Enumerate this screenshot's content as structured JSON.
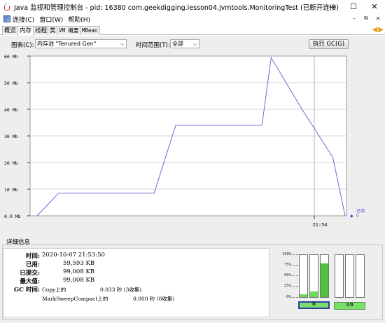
{
  "window": {
    "title": "Java 监视和管理控制台 - pid: 16380 com.geekdigging.lesson04.jvmtools.MonitoringTest (已断开连接)",
    "controls": {
      "minimize": "—",
      "maximize": "☐",
      "close": "✕"
    }
  },
  "menu": {
    "items": [
      "连接(C)",
      "窗口(W)",
      "帮助(H)"
    ],
    "inner_controls": [
      "–",
      "⧉",
      "✕"
    ]
  },
  "tabs": [
    "概览",
    "内存",
    "线程",
    "类",
    "VM 概要",
    "MBean"
  ],
  "active_tab": "内存",
  "controls": {
    "chart_label": "图表(C):",
    "chart_value": "内存池 \"Tenured Gen\"",
    "range_label": "时间范围(T):",
    "range_value": "全部",
    "gc_button": "执行 GC(G)"
  },
  "chart_data": {
    "type": "line",
    "y_ticks": [
      "60 Mb",
      "50 Mb",
      "40 Mb",
      "30 Mb",
      "20 Mb",
      "10 Mb",
      "0.0 Mb"
    ],
    "x_tick": "21:54",
    "ylim": [
      0,
      60
    ],
    "unit": "Mb",
    "grid": true,
    "series": [
      {
        "name": "已用",
        "color": "#6b6bd6",
        "points": [
          [
            0.0,
            0.0
          ],
          [
            0.07,
            8.5
          ],
          [
            0.38,
            8.5
          ],
          [
            0.45,
            34.0
          ],
          [
            0.73,
            34.0
          ],
          [
            0.76,
            59.4
          ],
          [
            0.86,
            40.0
          ],
          [
            0.96,
            22.0
          ],
          [
            1.0,
            0.0
          ]
        ]
      }
    ],
    "legend": {
      "label": "已用",
      "value": "0"
    }
  },
  "details": {
    "title": "详细信息",
    "time_label": "时间:",
    "time_value": "2020-10-07 21:53:50",
    "used_label": "已用:",
    "used_value": "59,593 KB",
    "committed_label": "已提交:",
    "committed_value": "99,008 KB",
    "max_label": "最大值:",
    "max_value": "99,008 KB",
    "gc_label": "GC 时间:",
    "gc_rows": [
      {
        "name": "Copy上的",
        "value": "0.033 秒 (3收集)"
      },
      {
        "name": "MarkSweepCompact上的",
        "value": "0.000 秒 (0收集)"
      }
    ]
  },
  "pools": {
    "axis": [
      "100%",
      "75%",
      "50%",
      "25%",
      "0%"
    ],
    "heap_label": "堆",
    "nonheap_label": "非堆",
    "heap_bars": [
      0.07,
      0.13,
      0.8
    ],
    "nonheap_bars": [
      0.0,
      0.0,
      0.0
    ]
  }
}
